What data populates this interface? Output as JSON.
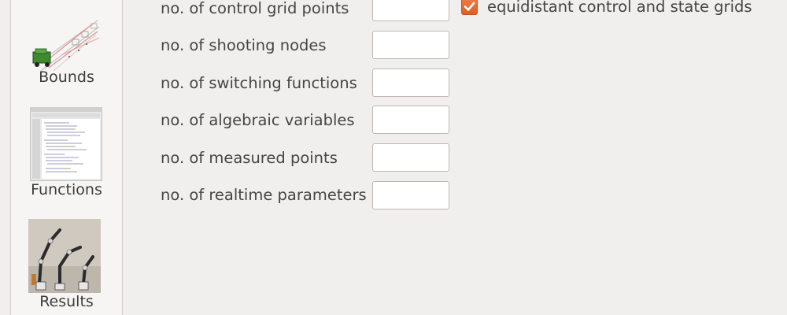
{
  "sidebar": {
    "items": [
      {
        "label": "Bounds",
        "icon": "bounds-vehicle-trajectory-icon"
      },
      {
        "label": "Functions",
        "icon": "functions-code-editor-icon"
      },
      {
        "label": "Results",
        "icon": "results-robot-arm-icon"
      }
    ]
  },
  "form": {
    "fields": [
      {
        "label": "no. of control grid points",
        "value": ""
      },
      {
        "label": "no. of shooting nodes",
        "value": ""
      },
      {
        "label": "no. of switching functions",
        "value": ""
      },
      {
        "label": "no. of algebraic variables",
        "value": ""
      },
      {
        "label": "no. of measured points",
        "value": ""
      },
      {
        "label": "no. of realtime parameters",
        "value": ""
      }
    ],
    "checkbox": {
      "label": "equidistant control and state grids",
      "checked": true
    }
  },
  "colors": {
    "accent": "#e8693a",
    "background": "#f0efee",
    "sidebar": "#f6f5f4"
  }
}
